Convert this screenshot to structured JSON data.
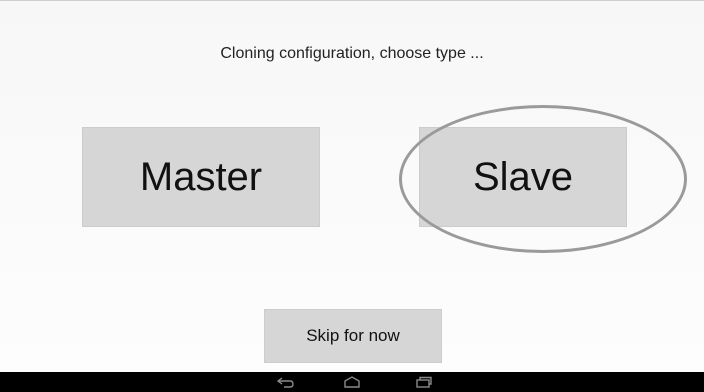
{
  "dialog": {
    "title": "Cloning configuration, choose type ...",
    "master_label": "Master",
    "slave_label": "Slave",
    "skip_label": "Skip for now"
  },
  "navbar": {
    "icons": [
      "back-icon",
      "home-icon",
      "recent-apps-icon"
    ]
  },
  "colors": {
    "button_bg": "#d6d6d6",
    "highlight_ring": "#9a9a9a",
    "navbar_bg": "#000000"
  }
}
